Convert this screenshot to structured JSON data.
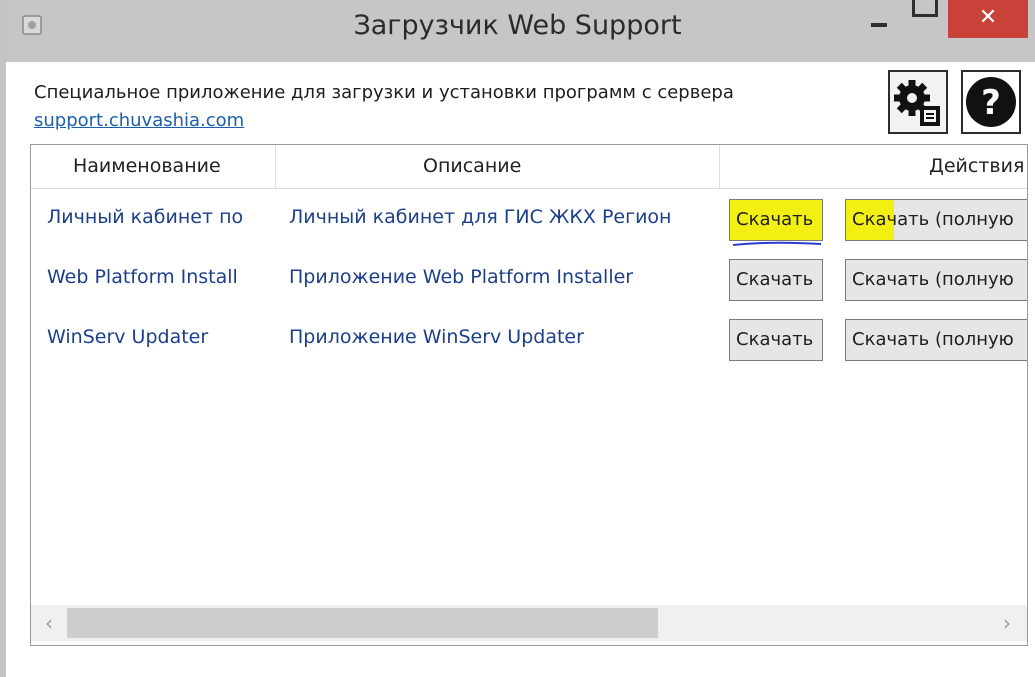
{
  "window": {
    "title": "Загрузчик Web Support",
    "close_label": "✕"
  },
  "header": {
    "description": "Специальное приложение для загрузки и установки программ с сервера",
    "link": "support.chuvashia.com"
  },
  "grid": {
    "columns": [
      "Наименование",
      "Описание",
      "Действия"
    ],
    "rows": [
      {
        "name": "Личный кабинет по",
        "description": "Личный кабинет для ГИС ЖКХ Регион",
        "download": "Скачать",
        "download_full": "Скачать (полную"
      },
      {
        "name": "Web Platform Install",
        "description": "Приложение Web Platform Installer",
        "download": "Скачать",
        "download_full": "Скачать (полную"
      },
      {
        "name": "WinServ Updater",
        "description": "Приложение WinServ Updater",
        "download": "Скачать",
        "download_full": "Скачать (полную"
      }
    ]
  },
  "scrollbar": {
    "left_arrow": "‹",
    "right_arrow": "›",
    "thumb_fraction": 0.64
  },
  "colors": {
    "highlight": "#f2ef12",
    "close_button": "#c9423a",
    "link": "#1c5fae",
    "row_text": "#1b3f8a"
  },
  "icons": {
    "app": "app-icon",
    "settings": "settings-gear-icon",
    "help": "help-question-icon"
  }
}
